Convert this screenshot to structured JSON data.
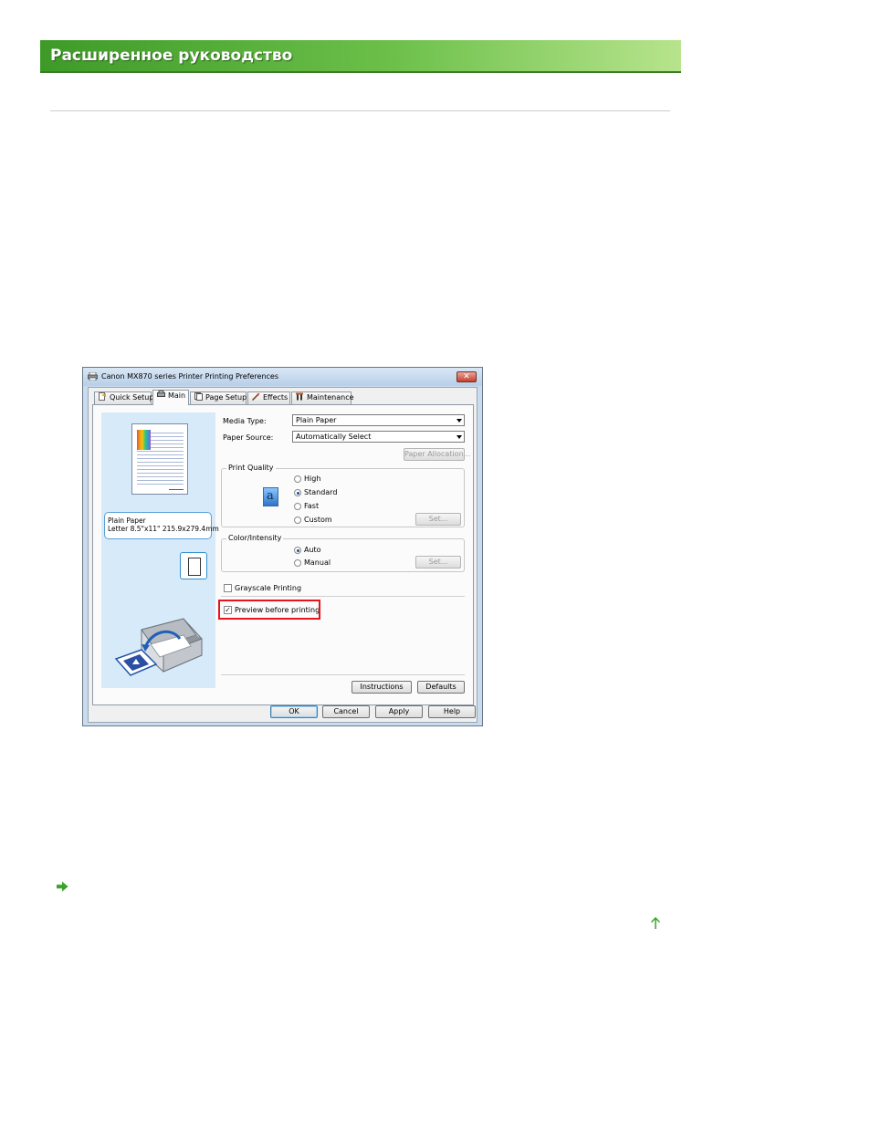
{
  "header": {
    "title": "Расширенное руководство"
  },
  "dialog": {
    "title": "Canon MX870 series Printer Printing Preferences",
    "tabs": [
      {
        "label": "Quick Setup",
        "icon": "quick-setup-icon"
      },
      {
        "label": "Main",
        "icon": "main-icon"
      },
      {
        "label": "Page Setup",
        "icon": "page-setup-icon"
      },
      {
        "label": "Effects",
        "icon": "effects-icon"
      },
      {
        "label": "Maintenance",
        "icon": "maintenance-icon"
      }
    ],
    "active_tab": "Main",
    "media_type": {
      "label": "Media Type:",
      "value": "Plain Paper"
    },
    "paper_source": {
      "label": "Paper Source:",
      "value": "Automatically Select"
    },
    "paper_allocation_button": "Paper Allocation...",
    "print_quality": {
      "title": "Print Quality",
      "options": [
        "High",
        "Standard",
        "Fast",
        "Custom"
      ],
      "selected": "Standard",
      "set_button": "Set..."
    },
    "color_intensity": {
      "title": "Color/Intensity",
      "options": [
        "Auto",
        "Manual"
      ],
      "selected": "Auto",
      "set_button": "Set..."
    },
    "grayscale_printing": {
      "label": "Grayscale Printing",
      "checked": false
    },
    "preview_before_printing": {
      "label": "Preview before printing",
      "checked": true
    },
    "paper_info": {
      "line1": "Plain Paper",
      "line2": "Letter 8.5\"x11\" 215.9x279.4mm"
    },
    "instructions_button": "Instructions",
    "defaults_button": "Defaults",
    "ok_button": "OK",
    "cancel_button": "Cancel",
    "apply_button": "Apply",
    "help_button": "Help",
    "highlight_color": "#e8141c"
  },
  "colors": {
    "banner_green": "#4fae33",
    "link_green": "#3aa32a"
  }
}
